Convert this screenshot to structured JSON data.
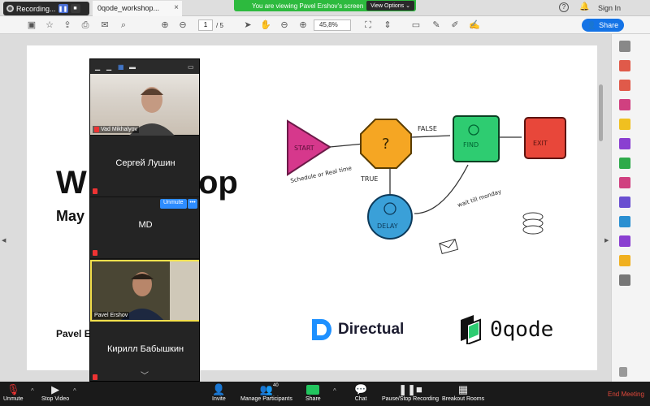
{
  "tabbar": {
    "recording_label": "Recording...",
    "tab_title": "0qode_workshop...",
    "tab_close": "×",
    "banner_text": "You are viewing Pavel Ershov's screen",
    "view_options": "View Options ⌄",
    "signin": "Sign In"
  },
  "toolbar": {
    "page_current": "1",
    "page_total": "/ 5",
    "zoom": "45,8%",
    "share_label": "Share"
  },
  "slide": {
    "title_left": "W",
    "title_right": "op",
    "date_partial": "May",
    "author_partial": "Pavel E",
    "sketch": {
      "start": "START",
      "question": "?",
      "find": "FIND",
      "exit": "EXIT",
      "delay": "DELAY",
      "false_label": "FALSE",
      "true_label": "TRUE",
      "schedule_note": "Schedule or Real time",
      "wait_note": "wait till monday"
    },
    "directual": "Directual",
    "qode": "0qode"
  },
  "participants": [
    {
      "name": "Vad Mikhalyov",
      "type": "video"
    },
    {
      "name": "Сергей Лушин",
      "type": "name"
    },
    {
      "name": "MD",
      "type": "name",
      "unmute": "Unmute",
      "more": "•••"
    },
    {
      "name": "Pavel Ershov",
      "type": "video"
    },
    {
      "name": "Кирилл Бабышкин",
      "type": "name"
    }
  ],
  "zoom_bar": {
    "unmute": "Unmute",
    "stop_video": "Stop Video",
    "invite": "Invite",
    "manage_participants": "Manage Participants",
    "participant_count": "40",
    "share": "Share",
    "chat": "Chat",
    "recording": "Pause/Stop Recording",
    "breakout": "Breakout Rooms",
    "end": "End Meeting"
  },
  "colors": {
    "start": "#d6388c",
    "question": "#f5a623",
    "find": "#2ecc71",
    "exit": "#e8473a",
    "delay": "#3aa0d8",
    "accent": "#1473e6",
    "zoom_share": "#22c55e"
  }
}
